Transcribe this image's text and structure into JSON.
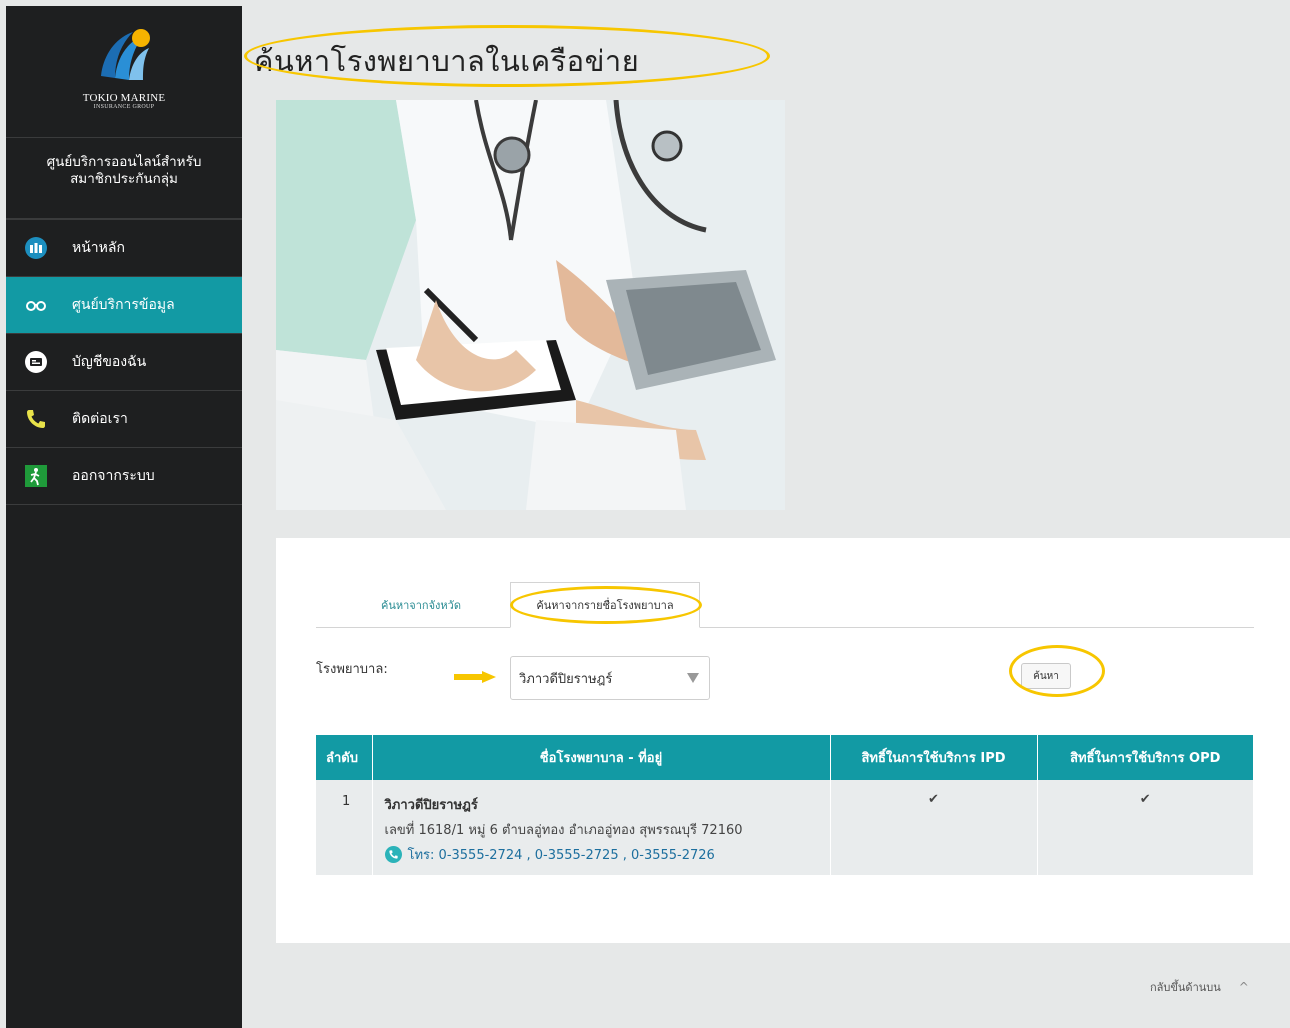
{
  "brand": {
    "logo_line1": "TOKIO MARINE",
    "logo_line2": "INSURANCE GROUP",
    "portal_line1": "ศูนย์บริการออนไลน์สำหรับ",
    "portal_line2": "สมาชิกประกันกลุ่ม"
  },
  "sidebar": {
    "items": [
      {
        "label": "หน้าหลัก",
        "icon": "people-icon"
      },
      {
        "label": "ศูนย์บริการข้อมูล",
        "icon": "glasses-icon",
        "active": true
      },
      {
        "label": "บัญชีของฉัน",
        "icon": "id-card-icon"
      },
      {
        "label": "ติดต่อเรา",
        "icon": "phone-icon"
      },
      {
        "label": "ออกจากระบบ",
        "icon": "exit-icon"
      }
    ]
  },
  "page": {
    "title": "ค้นหาโรงพยาบาลในเครือข่าย"
  },
  "search": {
    "tabs": [
      "ค้นหาจากจังหวัด",
      "ค้นหาจากรายชื่อโรงพยาบาล"
    ],
    "active_tab": 1,
    "hospital_label": "โรงพยาบาล:",
    "hospital_selected": "วิภาวดีปิยราษฎร์",
    "search_button": "ค้นหา"
  },
  "table": {
    "headers": [
      "ลำดับ",
      "ชื่อโรงพยาบาล - ที่อยู่",
      "สิทธิ์ในการใช้บริการ IPD",
      "สิทธิ์ในการใช้บริการ OPD"
    ],
    "rows": [
      {
        "index": "1",
        "name": "วิภาวดีปิยราษฎร์",
        "address": "เลขที่ 1618/1 หมู่ 6 ตำบลอู่ทอง อำเภออู่ทอง สุพรรณบุรี 72160",
        "phone": "โทร: 0-3555-2724 , 0-3555-2725 , 0-3555-2726",
        "ipd": "✔",
        "opd": "✔"
      }
    ]
  },
  "footer": {
    "back_to_top": "กลับขึ้นด้านบน",
    "caret": "^"
  },
  "colors": {
    "accent": "#129aa4",
    "highlight": "#f7c600",
    "sidebar_bg": "#1e1f20"
  }
}
